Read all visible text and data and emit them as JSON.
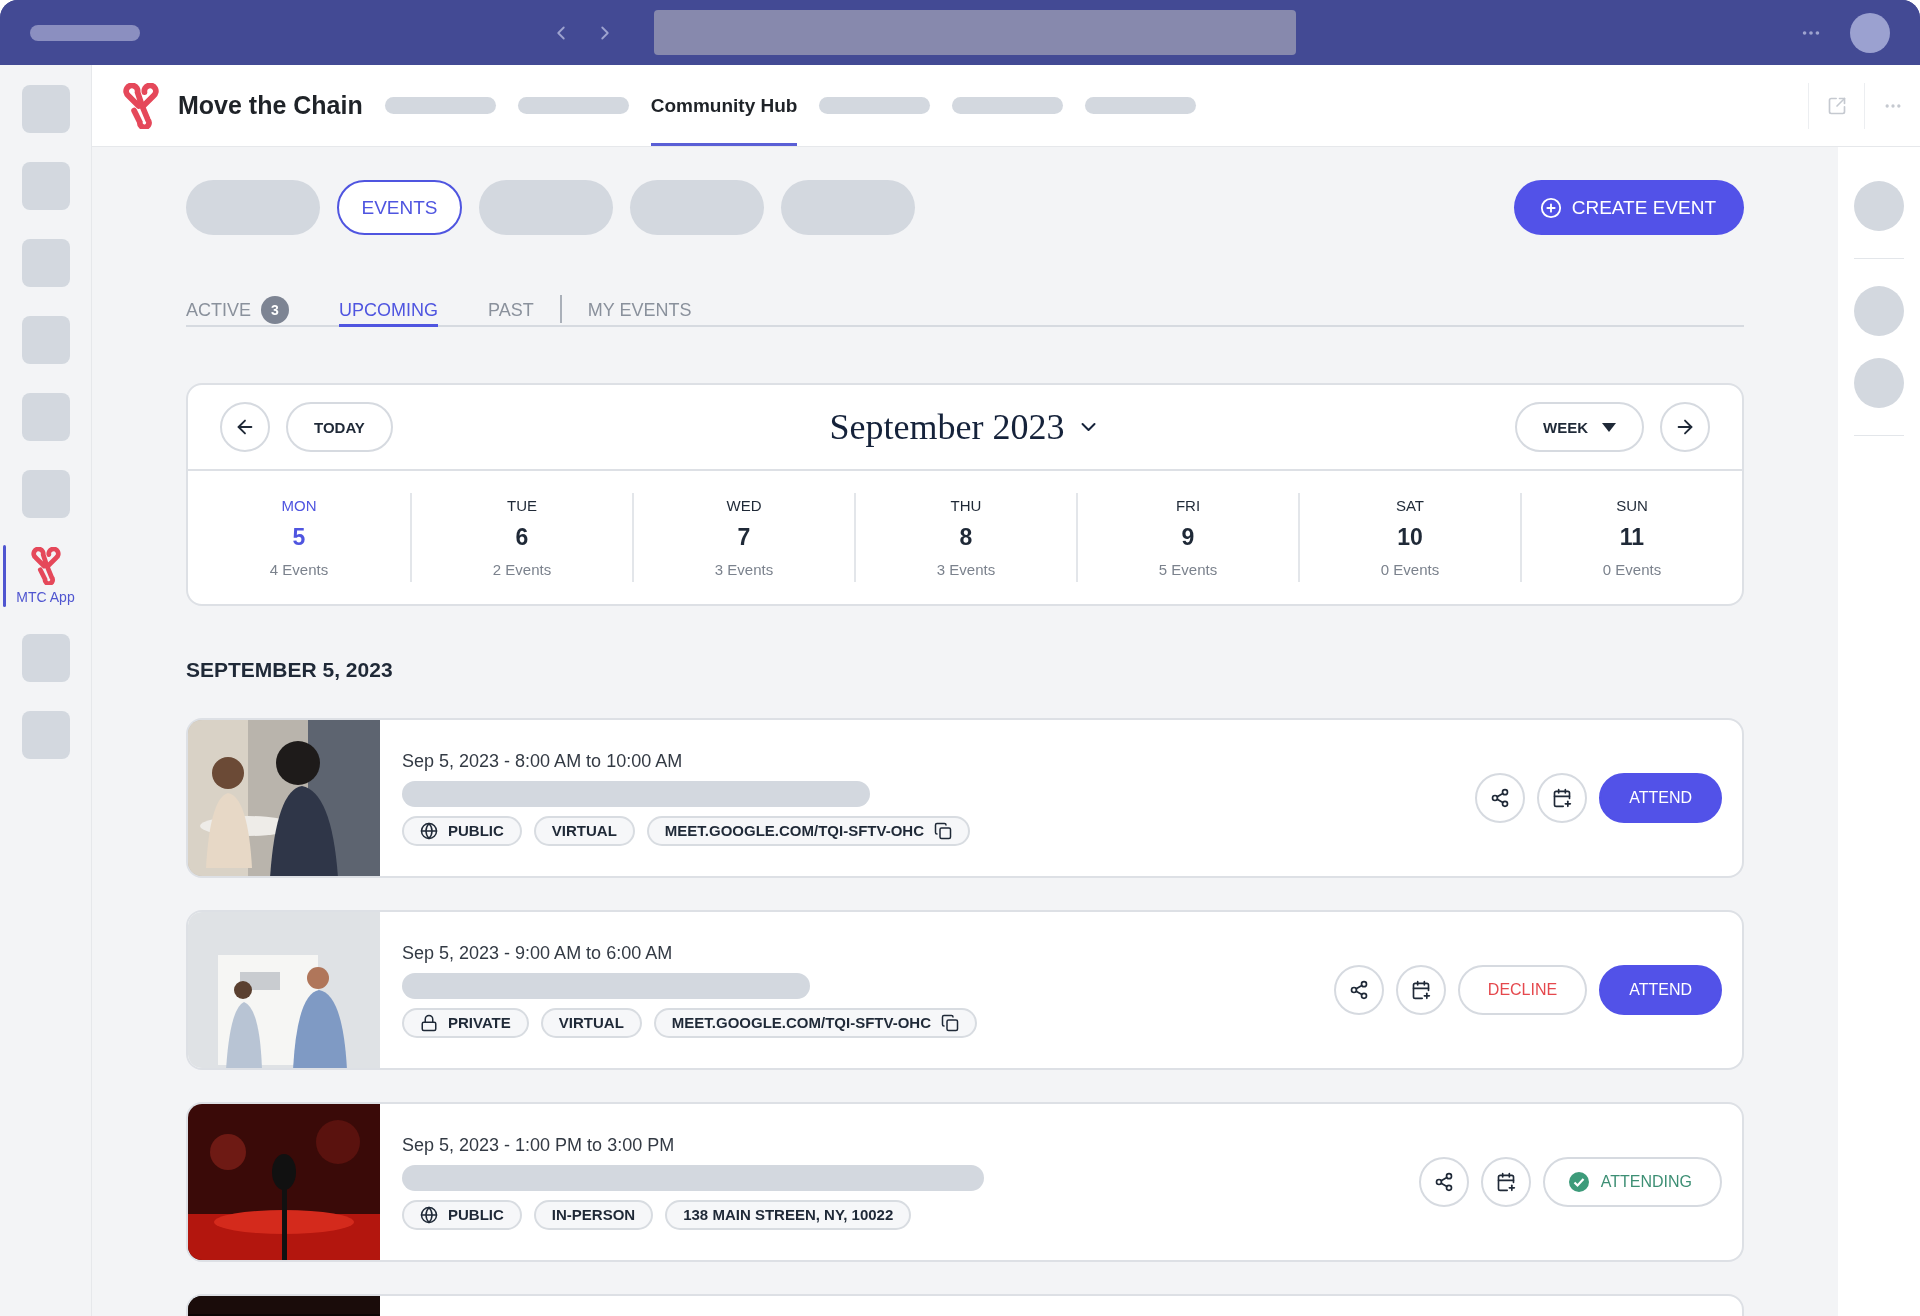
{
  "app_nav": [
    {
      "kind": "skeleton"
    },
    {
      "kind": "skeleton"
    },
    {
      "kind": "skeleton"
    },
    {
      "kind": "skeleton"
    },
    {
      "kind": "skeleton"
    },
    {
      "kind": "skeleton"
    },
    {
      "kind": "app",
      "label": "MTC App",
      "selected": true
    },
    {
      "kind": "skeleton"
    },
    {
      "kind": "skeleton"
    }
  ],
  "header": {
    "title": "Move the Chain",
    "tabs": [
      {
        "kind": "skeleton"
      },
      {
        "kind": "skeleton"
      },
      {
        "kind": "tab",
        "label": "Community Hub",
        "selected": true
      },
      {
        "kind": "skeleton"
      },
      {
        "kind": "skeleton"
      },
      {
        "kind": "skeleton"
      }
    ]
  },
  "filters": [
    {
      "kind": "skeleton"
    },
    {
      "kind": "chip",
      "label": "EVENTS",
      "selected": true
    },
    {
      "kind": "skeleton"
    },
    {
      "kind": "skeleton"
    },
    {
      "kind": "skeleton"
    }
  ],
  "create_button": "CREATE EVENT",
  "tabs": [
    {
      "label": "ACTIVE",
      "badge": "3",
      "selected": false
    },
    {
      "label": "UPCOMING",
      "selected": true
    },
    {
      "label": "PAST",
      "selected": false
    },
    {
      "label": "MY EVENTS",
      "selected": false
    }
  ],
  "calendar": {
    "today": "TODAY",
    "month": "September 2023",
    "view": "WEEK",
    "days": [
      {
        "weekday": "MON",
        "date": "5",
        "count": "4 Events",
        "selected": true
      },
      {
        "weekday": "TUE",
        "date": "6",
        "count": "2 Events",
        "selected": false
      },
      {
        "weekday": "WED",
        "date": "7",
        "count": "3 Events",
        "selected": false
      },
      {
        "weekday": "THU",
        "date": "8",
        "count": "3 Events",
        "selected": false
      },
      {
        "weekday": "FRI",
        "date": "9",
        "count": "5 Events",
        "selected": false
      },
      {
        "weekday": "SAT",
        "date": "10",
        "count": "0 Events",
        "selected": false
      },
      {
        "weekday": "SUN",
        "date": "11",
        "count": "0 Events",
        "selected": false
      }
    ]
  },
  "section_heading": "SEPTEMBER 5, 2023",
  "events": [
    {
      "kind": "picture",
      "time": "Sep 5, 2023 - 8:00 AM to 10:00 AM",
      "visibility": {
        "kind": "public",
        "label": "PUBLIC"
      },
      "format": "VIRTUAL",
      "location": {
        "label": "MEET.GOOGLE.COM/TQI-SFTV-OHC",
        "copyable": true
      },
      "actions": [
        {
          "kind": "attend",
          "label": "ATTEND"
        }
      ]
    },
    {
      "kind": "picture",
      "time": "Sep 5, 2023 - 9:00 AM to 6:00 AM",
      "visibility": {
        "kind": "private",
        "label": "PRIVATE"
      },
      "format": "VIRTUAL",
      "location": {
        "label": "MEET.GOOGLE.COM/TQI-SFTV-OHC",
        "copyable": true
      },
      "actions": [
        {
          "kind": "decline",
          "label": "DECLINE"
        },
        {
          "kind": "attend",
          "label": "ATTEND"
        }
      ]
    },
    {
      "kind": "picture",
      "time": "Sep 5, 2023 - 1:00 PM to 3:00 PM",
      "visibility": {
        "kind": "public",
        "label": "PUBLIC"
      },
      "format": "IN-PERSON",
      "location": {
        "label": "138 MAIN STREEN, NY, 10022",
        "copyable": false
      },
      "actions": [
        {
          "kind": "attending",
          "label": "ATTENDING"
        }
      ]
    },
    {
      "kind": "picture"
    }
  ]
}
